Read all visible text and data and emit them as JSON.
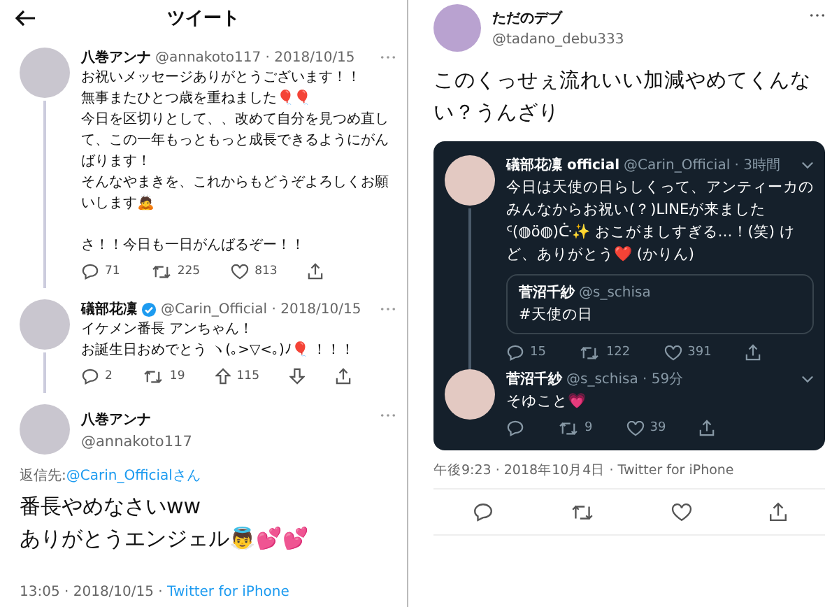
{
  "left": {
    "header": {
      "title": "ツイート"
    },
    "thread": [
      {
        "name": "八巻アンナ",
        "verified": false,
        "meta": "@annakoto117 · 2018/10/15",
        "paragraphs": [
          [
            "お祝いメッセージありがとうございます！！",
            "無事またひとつ歳を重ねました🎈🎈",
            "今日を区切りとして、、改めて自分を見つめ直して、この一年もっともっと成長できるようにがんばります！",
            "そんなやまきを、これからもどうぞよろしくお願いします🙇"
          ],
          [
            "さ！！今日も一日がんばるぞー！！"
          ]
        ],
        "actions": [
          {
            "kind": "reply",
            "count": "71"
          },
          {
            "kind": "retweet",
            "count": "225"
          },
          {
            "kind": "like",
            "count": "813"
          },
          {
            "kind": "share"
          }
        ]
      },
      {
        "name": "礒部花凜",
        "verified": true,
        "meta": "@Carin_Official · 2018/10/15",
        "paragraphs": [
          [
            "イケメン番長 アンちゃん！",
            "お誕生日おめでとう ヽ(｡>▽<｡)ﾉ🎈 ！！！"
          ]
        ],
        "actions": [
          {
            "kind": "reply",
            "count": "2"
          },
          {
            "kind": "retweet",
            "count": "19"
          },
          {
            "kind": "upvote",
            "count": "115"
          },
          {
            "kind": "downvote"
          },
          {
            "kind": "share"
          }
        ]
      }
    ],
    "main_tweet": {
      "name": "八巻アンナ",
      "handle": "@annakoto117",
      "reply_label": "返信先:",
      "reply_to": "@Carin_Officialさん",
      "lines": [
        "番長やめなさいww",
        "ありがとうエンジェル👼💕💕"
      ],
      "time": "13:05 · 2018/10/15 · ",
      "source": "Twitter for iPhone"
    }
  },
  "right": {
    "author": {
      "name": "ただのデブ",
      "handle": "@tadano_debu333"
    },
    "text": "このくっせぇ流れいい加減やめてくんない？うんざり",
    "quote": {
      "tweets": [
        {
          "name": "礒部花凜 official",
          "meta": "@Carin_Official · 3時間",
          "text": "今日は天使の日らしくって、アンティーカのみんなからお祝い(？)LINEが来ました ᑦ(◍ö◍)ᑤ✨ おこがましすぎる…！(笑) けど、ありがとう❤️ (かりん)",
          "quoted": {
            "name": "菅沼千紗",
            "handle": "@s_schisa",
            "text": "#天使の日"
          },
          "actions": [
            {
              "kind": "reply",
              "count": "15"
            },
            {
              "kind": "retweet",
              "count": "122"
            },
            {
              "kind": "like",
              "count": "391"
            },
            {
              "kind": "share"
            }
          ]
        },
        {
          "name": "菅沼千紗",
          "meta": "@s_schisa · 59分",
          "text": "そゆこと💗",
          "actions": [
            {
              "kind": "reply"
            },
            {
              "kind": "retweet",
              "count": "9"
            },
            {
              "kind": "like",
              "count": "39"
            },
            {
              "kind": "share"
            }
          ]
        }
      ]
    },
    "footer": "午後9:23 · 2018年10月4日 · Twitter for iPhone",
    "actions": [
      {
        "kind": "reply"
      },
      {
        "kind": "retweet"
      },
      {
        "kind": "like"
      },
      {
        "kind": "share"
      }
    ]
  }
}
